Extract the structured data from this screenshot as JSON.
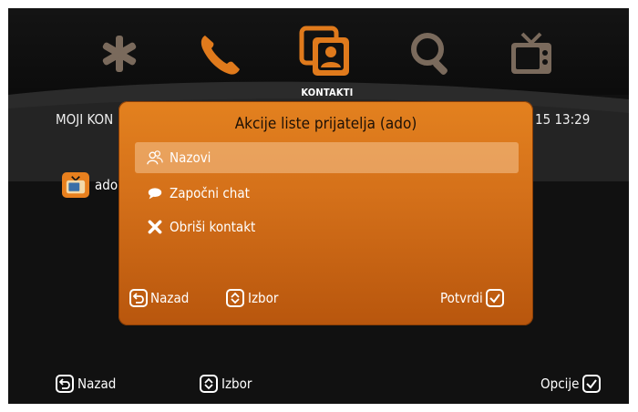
{
  "menu": {
    "items": [
      {
        "icon": "asterisk-icon"
      },
      {
        "icon": "phone-icon"
      },
      {
        "icon": "contacts-icon",
        "label": "KONTAKTI",
        "active": true
      },
      {
        "icon": "search-icon"
      },
      {
        "icon": "tv-icon"
      }
    ]
  },
  "header": {
    "title": "MOJI KON",
    "clock": "15   13:29"
  },
  "contacts": {
    "items": [
      {
        "name": "ado",
        "icon": "tv-icon"
      }
    ]
  },
  "dialog": {
    "title": "Akcije liste prijatelja (ado)",
    "options": [
      {
        "label": "Nazovi",
        "icon": "people-icon",
        "selected": true
      },
      {
        "label": "Započni chat",
        "icon": "chat-bubble-icon"
      },
      {
        "label": "Obriši kontakt",
        "icon": "x-icon"
      }
    ],
    "back_label": "Nazad",
    "select_label": "Izbor",
    "confirm_label": "Potvrdi"
  },
  "bottom_bar": {
    "back_label": "Nazad",
    "select_label": "Izbor",
    "options_label": "Opcije"
  },
  "colors": {
    "accent_orange": "#e07a1c",
    "background": "#111111",
    "text": "#ffffff"
  }
}
